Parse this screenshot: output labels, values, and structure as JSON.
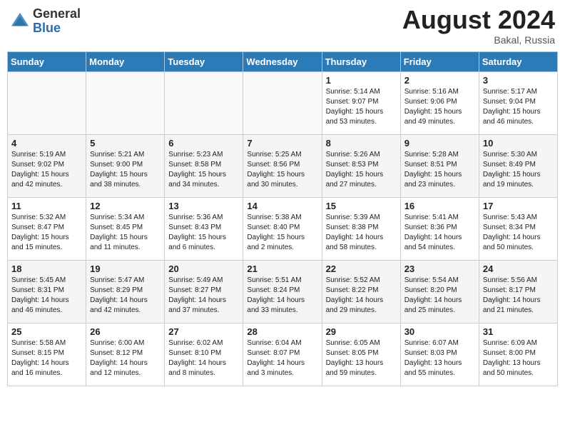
{
  "header": {
    "logo_general": "General",
    "logo_blue": "Blue",
    "month_year": "August 2024",
    "location": "Bakal, Russia"
  },
  "days_of_week": [
    "Sunday",
    "Monday",
    "Tuesday",
    "Wednesday",
    "Thursday",
    "Friday",
    "Saturday"
  ],
  "weeks": [
    [
      {
        "day": "",
        "info": ""
      },
      {
        "day": "",
        "info": ""
      },
      {
        "day": "",
        "info": ""
      },
      {
        "day": "",
        "info": ""
      },
      {
        "day": "1",
        "info": "Sunrise: 5:14 AM\nSunset: 9:07 PM\nDaylight: 15 hours\nand 53 minutes."
      },
      {
        "day": "2",
        "info": "Sunrise: 5:16 AM\nSunset: 9:06 PM\nDaylight: 15 hours\nand 49 minutes."
      },
      {
        "day": "3",
        "info": "Sunrise: 5:17 AM\nSunset: 9:04 PM\nDaylight: 15 hours\nand 46 minutes."
      }
    ],
    [
      {
        "day": "4",
        "info": "Sunrise: 5:19 AM\nSunset: 9:02 PM\nDaylight: 15 hours\nand 42 minutes."
      },
      {
        "day": "5",
        "info": "Sunrise: 5:21 AM\nSunset: 9:00 PM\nDaylight: 15 hours\nand 38 minutes."
      },
      {
        "day": "6",
        "info": "Sunrise: 5:23 AM\nSunset: 8:58 PM\nDaylight: 15 hours\nand 34 minutes."
      },
      {
        "day": "7",
        "info": "Sunrise: 5:25 AM\nSunset: 8:56 PM\nDaylight: 15 hours\nand 30 minutes."
      },
      {
        "day": "8",
        "info": "Sunrise: 5:26 AM\nSunset: 8:53 PM\nDaylight: 15 hours\nand 27 minutes."
      },
      {
        "day": "9",
        "info": "Sunrise: 5:28 AM\nSunset: 8:51 PM\nDaylight: 15 hours\nand 23 minutes."
      },
      {
        "day": "10",
        "info": "Sunrise: 5:30 AM\nSunset: 8:49 PM\nDaylight: 15 hours\nand 19 minutes."
      }
    ],
    [
      {
        "day": "11",
        "info": "Sunrise: 5:32 AM\nSunset: 8:47 PM\nDaylight: 15 hours\nand 15 minutes."
      },
      {
        "day": "12",
        "info": "Sunrise: 5:34 AM\nSunset: 8:45 PM\nDaylight: 15 hours\nand 11 minutes."
      },
      {
        "day": "13",
        "info": "Sunrise: 5:36 AM\nSunset: 8:43 PM\nDaylight: 15 hours\nand 6 minutes."
      },
      {
        "day": "14",
        "info": "Sunrise: 5:38 AM\nSunset: 8:40 PM\nDaylight: 15 hours\nand 2 minutes."
      },
      {
        "day": "15",
        "info": "Sunrise: 5:39 AM\nSunset: 8:38 PM\nDaylight: 14 hours\nand 58 minutes."
      },
      {
        "day": "16",
        "info": "Sunrise: 5:41 AM\nSunset: 8:36 PM\nDaylight: 14 hours\nand 54 minutes."
      },
      {
        "day": "17",
        "info": "Sunrise: 5:43 AM\nSunset: 8:34 PM\nDaylight: 14 hours\nand 50 minutes."
      }
    ],
    [
      {
        "day": "18",
        "info": "Sunrise: 5:45 AM\nSunset: 8:31 PM\nDaylight: 14 hours\nand 46 minutes."
      },
      {
        "day": "19",
        "info": "Sunrise: 5:47 AM\nSunset: 8:29 PM\nDaylight: 14 hours\nand 42 minutes."
      },
      {
        "day": "20",
        "info": "Sunrise: 5:49 AM\nSunset: 8:27 PM\nDaylight: 14 hours\nand 37 minutes."
      },
      {
        "day": "21",
        "info": "Sunrise: 5:51 AM\nSunset: 8:24 PM\nDaylight: 14 hours\nand 33 minutes."
      },
      {
        "day": "22",
        "info": "Sunrise: 5:52 AM\nSunset: 8:22 PM\nDaylight: 14 hours\nand 29 minutes."
      },
      {
        "day": "23",
        "info": "Sunrise: 5:54 AM\nSunset: 8:20 PM\nDaylight: 14 hours\nand 25 minutes."
      },
      {
        "day": "24",
        "info": "Sunrise: 5:56 AM\nSunset: 8:17 PM\nDaylight: 14 hours\nand 21 minutes."
      }
    ],
    [
      {
        "day": "25",
        "info": "Sunrise: 5:58 AM\nSunset: 8:15 PM\nDaylight: 14 hours\nand 16 minutes."
      },
      {
        "day": "26",
        "info": "Sunrise: 6:00 AM\nSunset: 8:12 PM\nDaylight: 14 hours\nand 12 minutes."
      },
      {
        "day": "27",
        "info": "Sunrise: 6:02 AM\nSunset: 8:10 PM\nDaylight: 14 hours\nand 8 minutes."
      },
      {
        "day": "28",
        "info": "Sunrise: 6:04 AM\nSunset: 8:07 PM\nDaylight: 14 hours\nand 3 minutes."
      },
      {
        "day": "29",
        "info": "Sunrise: 6:05 AM\nSunset: 8:05 PM\nDaylight: 13 hours\nand 59 minutes."
      },
      {
        "day": "30",
        "info": "Sunrise: 6:07 AM\nSunset: 8:03 PM\nDaylight: 13 hours\nand 55 minutes."
      },
      {
        "day": "31",
        "info": "Sunrise: 6:09 AM\nSunset: 8:00 PM\nDaylight: 13 hours\nand 50 minutes."
      }
    ]
  ]
}
